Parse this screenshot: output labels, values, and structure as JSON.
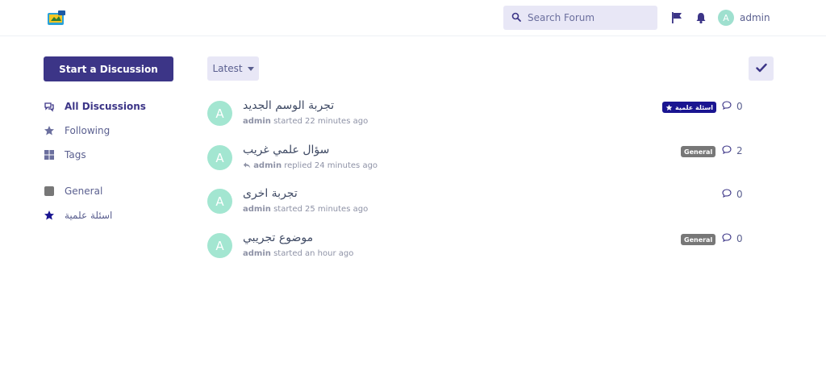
{
  "header": {
    "search_placeholder": "Search Forum",
    "user_initial": "A",
    "user_name": "admin"
  },
  "sidebar": {
    "start_button": "Start a Discussion",
    "nav": [
      {
        "label": "All Discussions",
        "icon": "comments-icon",
        "active": true
      },
      {
        "label": "Following",
        "icon": "star-icon",
        "active": false
      },
      {
        "label": "Tags",
        "icon": "tags-grid-icon",
        "active": false
      }
    ],
    "tags": [
      {
        "label": "General",
        "icon": "tag-square-icon",
        "color": "#777777"
      },
      {
        "label": "اسئلة علمية",
        "icon": "star-icon",
        "color": "#1a1591"
      }
    ]
  },
  "toolbar": {
    "sort_label": "Latest"
  },
  "discussions": [
    {
      "initial": "A",
      "title": "تجربة الوسم الجديد",
      "author": "admin",
      "action": "started 22 minutes ago",
      "tag": "اسئلة علمية",
      "replies": "0"
    },
    {
      "initial": "A",
      "title": "سؤال علمي غريب",
      "author": "admin",
      "action": "replied 24 minutes ago",
      "tag": "General",
      "replies": "2"
    },
    {
      "initial": "A",
      "title": "تجربة اخرى",
      "author": "admin",
      "action": "started 25 minutes ago",
      "tag": "",
      "replies": "0"
    },
    {
      "initial": "A",
      "title": "موضوع تجريبي",
      "author": "admin",
      "action": "started an hour ago",
      "tag": "General",
      "replies": "0"
    }
  ],
  "colors": {
    "primary": "#3c3587",
    "control_bg": "#e8e7f6",
    "avatar": "#a3e6d1",
    "tag_general": "#777777",
    "tag_science": "#1a1591"
  }
}
